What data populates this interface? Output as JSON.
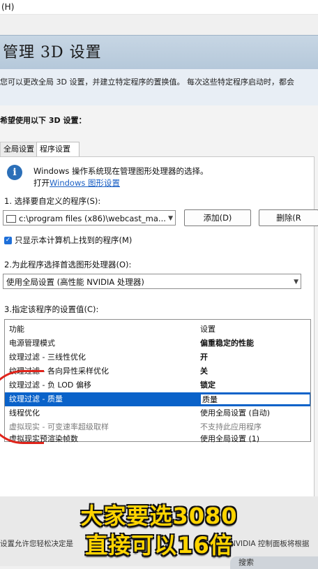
{
  "menubar": {
    "help": "(H)"
  },
  "header": {
    "title": "管理 3D 设置"
  },
  "description": "您可以更改全局 3D 设置，并建立特定程序的置换值。 每次这些特定程序启动时，都会",
  "section_label": "希望使用以下 3D 设置：",
  "tabs": [
    {
      "label": "全局设置",
      "active": false
    },
    {
      "label": "程序设置",
      "active": true
    }
  ],
  "info": {
    "text": "Windows 操作系统现在管理图形处理器的选择。",
    "link_prefix": "打开",
    "link_text": "Windows 图形设置"
  },
  "step1": {
    "label": "1. 选择要自定义的程序(S):",
    "program_value": "c:\\program files (x86)\\webcast_ma...",
    "add_button": "添加(D)",
    "remove_button": "删除(R"
  },
  "checkbox": {
    "label": "只显示本计算机上找到的程序(M)",
    "checked": true
  },
  "step2": {
    "label": "2.为此程序选择首选图形处理器(O):",
    "value": "使用全局设置 (高性能 NVIDIA 处理器)"
  },
  "step3": {
    "label": "3.指定该程序的设置值(C):",
    "headers": {
      "feature": "功能",
      "setting": "设置"
    },
    "rows": [
      {
        "feature": "电源管理模式",
        "setting": "偏重稳定的性能",
        "style": "bold"
      },
      {
        "feature": "纹理过滤 - 三线性优化",
        "setting": "开",
        "style": "bold"
      },
      {
        "feature": "纹理过滤 - 各向异性采样优化",
        "setting": "关",
        "style": "bold"
      },
      {
        "feature": "纹理过滤 - 负 LOD 偏移",
        "setting": "锁定",
        "style": "bold"
      },
      {
        "feature": "纹理过滤 - 质量",
        "setting": "质量",
        "style": "selected"
      },
      {
        "feature": "线程优化",
        "setting": "使用全局设置 (自动)",
        "style": "normal"
      },
      {
        "feature": "虚拟现实 - 可变速率超级取样",
        "setting": "不支持此应用程序",
        "style": "gray"
      },
      {
        "feature": "虚拟现实预渲染帧数",
        "setting": "使用全局设置 (1)",
        "style": "normal"
      }
    ]
  },
  "bottom": {
    "left_text": "设置允许您轻松决定是",
    "right_text": "NVIDIA 控制面板将根据"
  },
  "caption": {
    "line1": "大家要选3080",
    "line2": "直接可以16倍"
  },
  "taskbar": {
    "search": "搜索"
  },
  "colors": {
    "selection": "#0a62c9",
    "caption": "#ffd400",
    "annotation": "#e0241b"
  }
}
